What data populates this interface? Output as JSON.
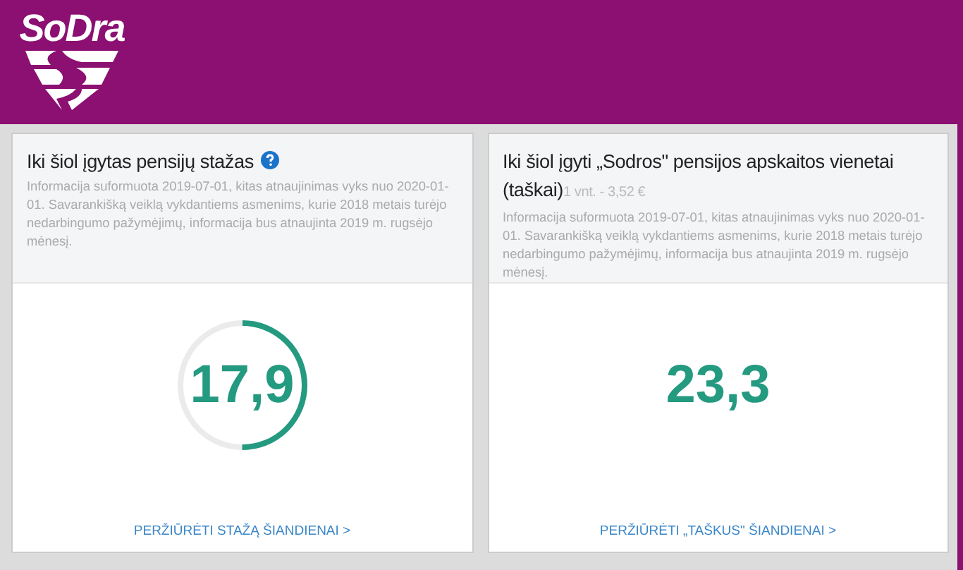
{
  "header": {
    "logo": "SoDra"
  },
  "cards": [
    {
      "kind": "ring",
      "title": "Iki šiol įgytas pensijų stažas",
      "help": true,
      "info": "Informacija suformuota 2019-07-01, kitas atnaujinimas vyks nuo 2020-01-01. Savarankišką veiklą vykdantiems asmenims, kurie 2018 metais turėjo nedarbingumo pažymėjimų, informacija bus atnaujinta 2019 m. rugsėjo mėnesį.",
      "value": "17,9",
      "level": 0.5,
      "link": "PERŽIŪRĖTI STAŽĄ ŠIANDIENAI >"
    },
    {
      "kind": "plain",
      "title": "Iki šiol įgyti „Sodros\" pensijos apskaitos vienetai (taškai)",
      "help": false,
      "note": "1 vnt. - 3,52 €",
      "info": "Informacija suformuota 2019-07-01, kitas atnaujinimas vyks nuo 2020-01-01. Savarankišką veiklą vykdantiems asmenims, kurie 2018 metais turėjo nedarbingumo pažymėjimų, informacija bus atnaujinta 2019 m. rugsėjo mėnesį.",
      "value": "23,3",
      "link": "PERŽIŪRĖTI „TAŠKUS\" ŠIANDIENAI >"
    }
  ]
}
